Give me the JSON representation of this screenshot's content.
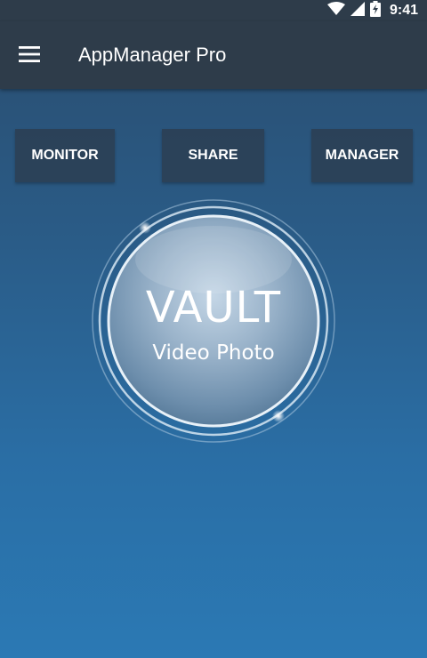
{
  "status_bar": {
    "time": "9:41",
    "icons": [
      "wifi-icon",
      "signal-icon",
      "battery-charging-icon"
    ]
  },
  "app_bar": {
    "menu_icon": "hamburger-menu-icon",
    "title": "AppManager Pro"
  },
  "tabs": [
    {
      "label": "MONITOR"
    },
    {
      "label": "SHARE"
    },
    {
      "label": "MANAGER"
    }
  ],
  "vault": {
    "title": "VAULT",
    "subtitle": "Video Photo"
  },
  "colors": {
    "app_bar": "#2e3c4a",
    "background_top": "#2a4d6f",
    "background_bottom": "#2b79b4",
    "button_bg": "#2c3e52",
    "text": "#ffffff"
  }
}
